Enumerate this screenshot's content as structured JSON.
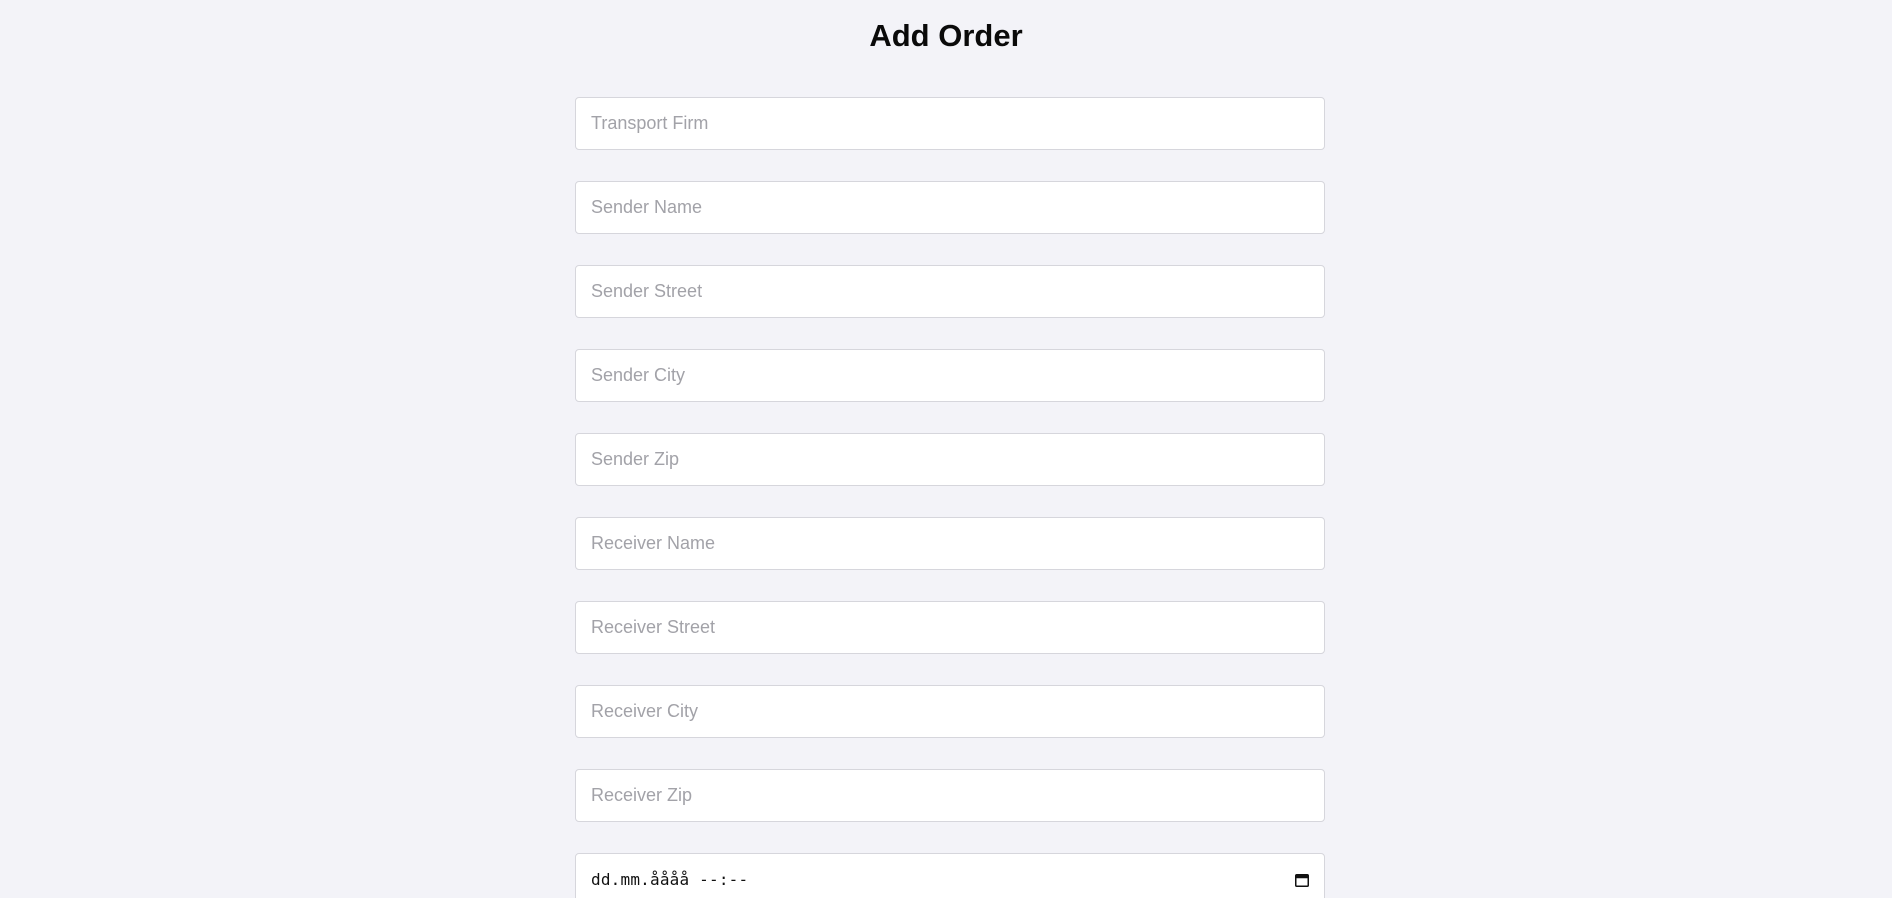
{
  "page": {
    "title": "Add Order"
  },
  "form": {
    "fields": [
      {
        "placeholder": "Transport Firm",
        "value": ""
      },
      {
        "placeholder": "Sender Name",
        "value": ""
      },
      {
        "placeholder": "Sender Street",
        "value": ""
      },
      {
        "placeholder": "Sender City",
        "value": ""
      },
      {
        "placeholder": "Sender Zip",
        "value": ""
      },
      {
        "placeholder": "Receiver Name",
        "value": ""
      },
      {
        "placeholder": "Receiver Street",
        "value": ""
      },
      {
        "placeholder": "Receiver City",
        "value": ""
      },
      {
        "placeholder": "Receiver Zip",
        "value": ""
      }
    ],
    "datetime": {
      "display": "dd.mm.åååå --:--",
      "icon": "calendar-icon"
    }
  }
}
